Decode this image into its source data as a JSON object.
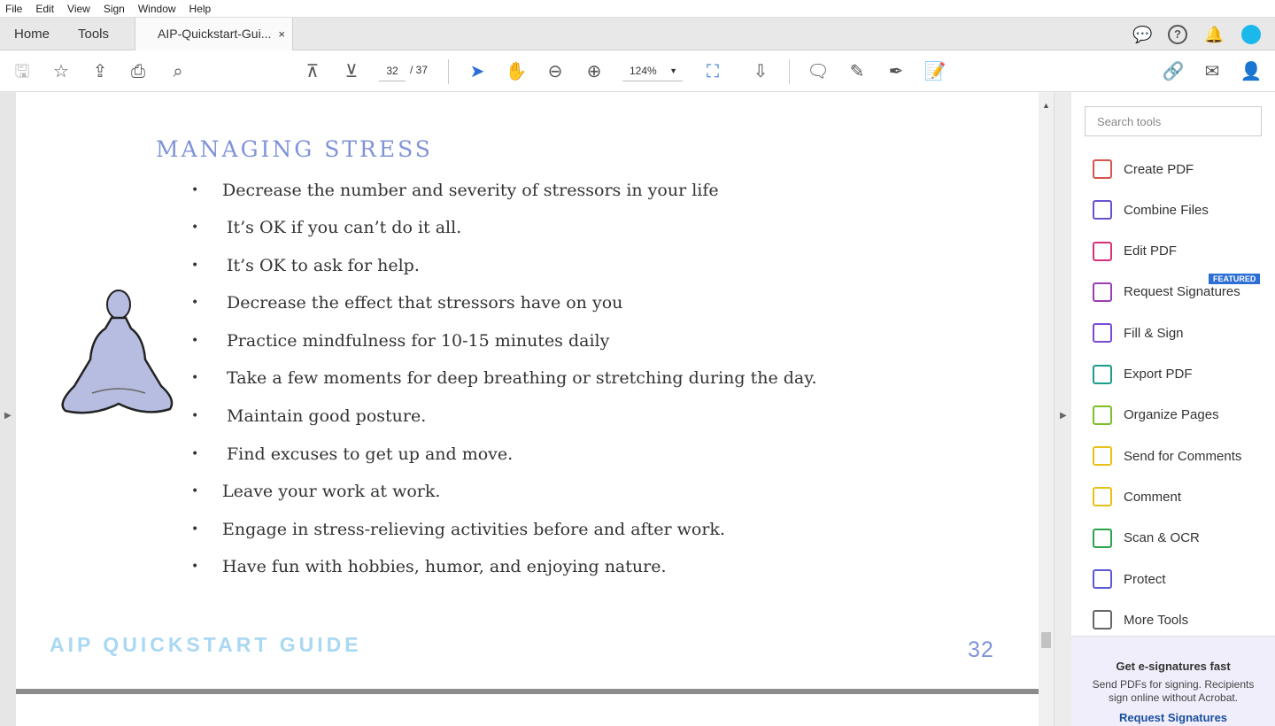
{
  "menu": [
    "File",
    "Edit",
    "View",
    "Sign",
    "Window",
    "Help"
  ],
  "tabs": {
    "home": "Home",
    "tools": "Tools",
    "document": "AIP-Quickstart-Gui...",
    "close": "×"
  },
  "toolbar": {
    "page_current": "32",
    "page_total": "/ 37",
    "zoom": "124%"
  },
  "document": {
    "title": "MANAGING STRESS",
    "bullets": [
      "Decrease the number and severity of stressors in your life",
      "It’s OK if you can’t do it all.",
      "It’s OK to ask for help.",
      "Decrease the effect that stressors have on you",
      "Practice mindfulness for 10-15 minutes daily",
      "Take a few moments for deep breathing or stretching during the day.",
      "Maintain good posture.",
      "Find excuses to get up and move.",
      "Leave your work at work.",
      "Engage in stress-relieving activities before and after work.",
      "Have fun with hobbies, humor, and enjoying nature."
    ],
    "bullet_char": "•",
    "footer": "AIP QUICKSTART GUIDE",
    "page_number": "32"
  },
  "right_pane": {
    "search_placeholder": "Search tools",
    "tools": [
      {
        "label": "Create PDF",
        "color": "#d9534f"
      },
      {
        "label": "Combine Files",
        "color": "#6a4fd0"
      },
      {
        "label": "Edit PDF",
        "color": "#d6307a"
      },
      {
        "label": "Request Signatures",
        "color": "#9b3db5"
      },
      {
        "label": "Fill & Sign",
        "color": "#7a4bd6"
      },
      {
        "label": "Export PDF",
        "color": "#1d9c8b"
      },
      {
        "label": "Organize Pages",
        "color": "#7cbf2a"
      },
      {
        "label": "Send for Comments",
        "color": "#e8c019"
      },
      {
        "label": "Comment",
        "color": "#e8c019"
      },
      {
        "label": "Scan & OCR",
        "color": "#2aa34a"
      },
      {
        "label": "Protect",
        "color": "#5a5ad6"
      },
      {
        "label": "More Tools",
        "color": "#666666"
      }
    ],
    "featured_badge": "FEATURED",
    "promo": {
      "title": "Get e-signatures fast",
      "text": "Send PDFs for signing. Recipients sign online without Acrobat.",
      "link": "Request Signatures"
    }
  }
}
